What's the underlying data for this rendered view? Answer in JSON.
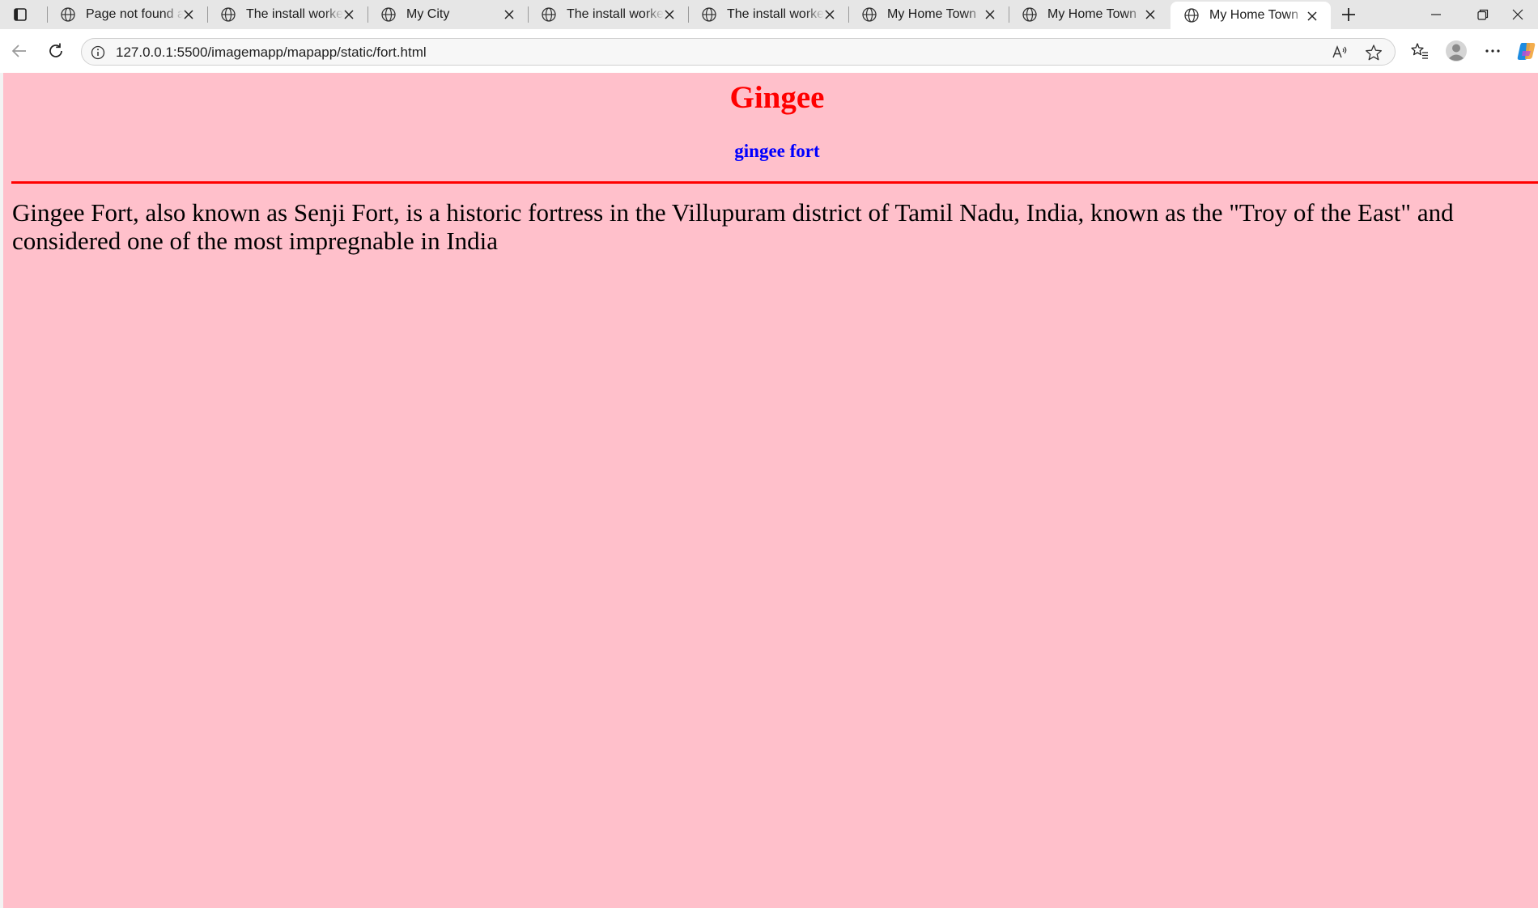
{
  "browser": {
    "tabs": [
      {
        "title": "Page not found at"
      },
      {
        "title": "The install worked"
      },
      {
        "title": "My City"
      },
      {
        "title": "The install worked"
      },
      {
        "title": "The install worked"
      },
      {
        "title": "My Home Town"
      },
      {
        "title": "My Home Town"
      },
      {
        "title": "My Home Town",
        "active": true
      }
    ],
    "address_bar": {
      "url": "127.0.0.1:5500/imagemapp/mapapp/static/fort.html"
    }
  },
  "page": {
    "heading": "Gingee",
    "subheading": "gingee fort",
    "paragraph": "Gingee Fort, also known as Senji Fort, is a historic fortress in the Villupuram district of Tamil Nadu, India, known as the \"Troy of the East\" and considered one of the most impregnable in India",
    "colors": {
      "background": "#ffc0cb",
      "heading": "#ff0000",
      "subheading": "#0000ff",
      "rule": "#ff0000"
    }
  },
  "icons": [
    "tab-actions-icon",
    "globe-icon",
    "close-icon",
    "new-tab-icon",
    "minimize-icon",
    "restore-icon",
    "window-close-icon",
    "back-icon",
    "refresh-icon",
    "site-info-icon",
    "read-aloud-icon",
    "favorite-star-icon",
    "favorites-icon",
    "profile-icon",
    "more-icon",
    "copilot-icon"
  ]
}
